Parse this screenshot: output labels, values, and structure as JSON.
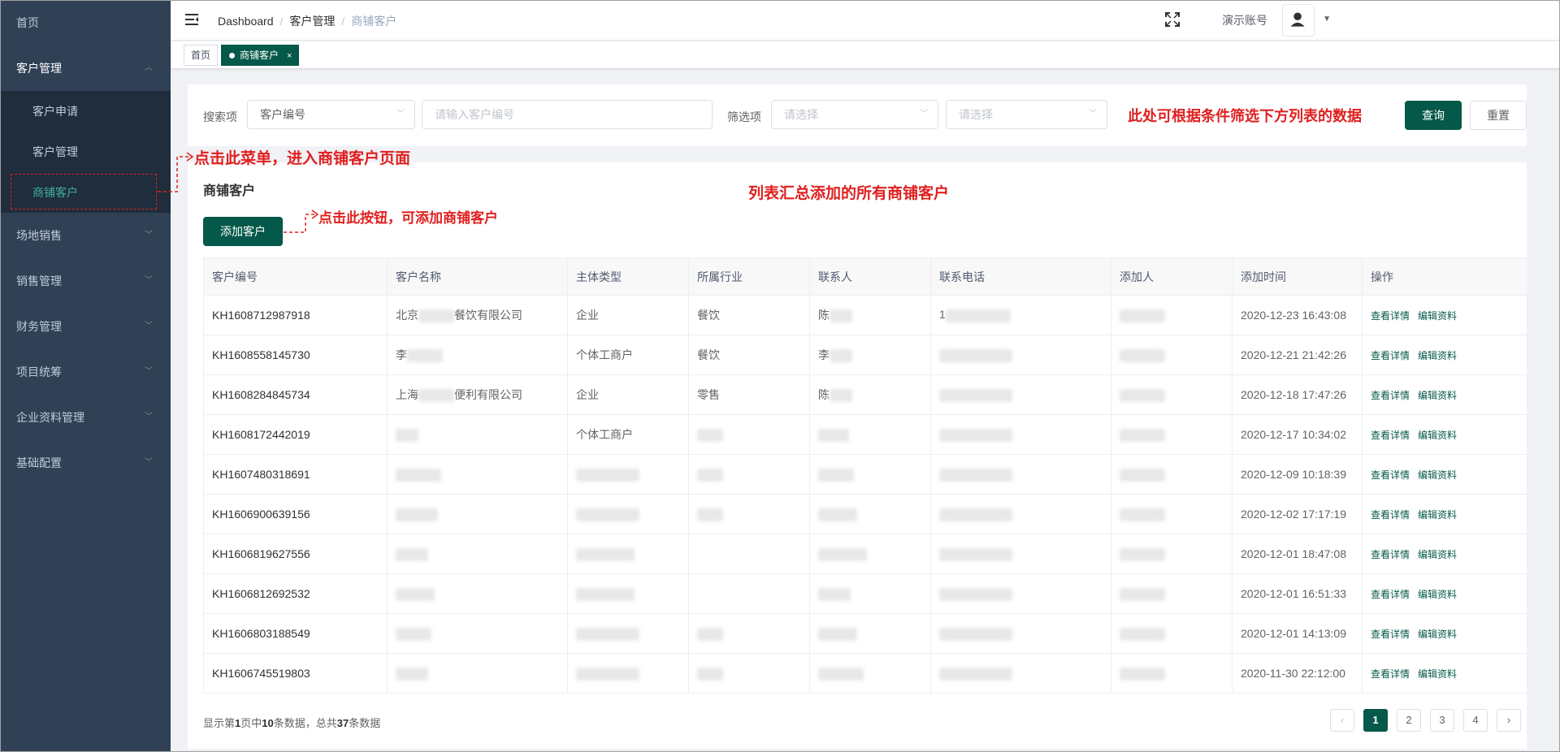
{
  "sidebar": {
    "items": [
      {
        "label": "首页"
      },
      {
        "label": "客户管理",
        "expanded": true,
        "children": [
          {
            "label": "客户申请"
          },
          {
            "label": "客户管理"
          },
          {
            "label": "商铺客户",
            "active": true
          }
        ]
      },
      {
        "label": "场地销售"
      },
      {
        "label": "销售管理"
      },
      {
        "label": "财务管理"
      },
      {
        "label": "项目统筹"
      },
      {
        "label": "企业资料管理"
      },
      {
        "label": "基础配置"
      }
    ]
  },
  "header": {
    "breadcrumb": [
      "Dashboard",
      "客户管理",
      "商铺客户"
    ],
    "account_name": "演示账号"
  },
  "tags": [
    {
      "label": "首页"
    },
    {
      "label": "商铺客户",
      "close": "×"
    }
  ],
  "search": {
    "search_label": "搜索项",
    "search_field": "客户编号",
    "search_input_placeholder": "请输入客户编号",
    "filter_label": "筛选项",
    "filter1_placeholder": "请选择",
    "filter2_placeholder": "请选择",
    "query_button": "查询",
    "reset_button": "重置"
  },
  "panel": {
    "title": "商铺客户",
    "add_button": "添加客户"
  },
  "table": {
    "columns": [
      "客户编号",
      "客户名称",
      "主体类型",
      "所属行业",
      "联系人",
      "联系电话",
      "添加人",
      "添加时间",
      "操作"
    ],
    "rows": [
      {
        "code": "KH1608712987918",
        "name_pre": "北京",
        "name_post": "餐饮有限公司",
        "type": "企业",
        "industry": "餐饮",
        "contact": "陈",
        "phone": "1",
        "time": "2020-12-23 16:43:08"
      },
      {
        "code": "KH1608558145730",
        "name_pre": "李",
        "name_post": "",
        "type": "个体工商户",
        "industry": "餐饮",
        "contact": "李",
        "phone": "",
        "time": "2020-12-21 21:42:26"
      },
      {
        "code": "KH1608284845734",
        "name_pre": "上海",
        "name_post": "便利有限公司",
        "type": "企业",
        "industry": "零售",
        "contact": "陈",
        "phone": "",
        "time": "2020-12-18 17:47:26"
      },
      {
        "code": "KH1608172442019",
        "name_pre": "",
        "name_post": "",
        "type": "个体工商户",
        "industry": "",
        "contact": "",
        "phone": "",
        "time": "2020-12-17 10:34:02"
      },
      {
        "code": "KH1607480318691",
        "name_pre": "",
        "name_post": "",
        "type": "",
        "industry": "",
        "contact": "",
        "phone": "",
        "time": "2020-12-09 10:18:39"
      },
      {
        "code": "KH1606900639156",
        "name_pre": "",
        "name_post": "",
        "type": "",
        "industry": "",
        "contact": "",
        "phone": "",
        "time": "2020-12-02 17:17:19"
      },
      {
        "code": "KH1606819627556",
        "name_pre": "",
        "name_post": "",
        "type": "",
        "industry": "",
        "contact": "",
        "phone": "",
        "time": "2020-12-01 18:47:08"
      },
      {
        "code": "KH1606812692532",
        "name_pre": "",
        "name_post": "",
        "type": "",
        "industry": "",
        "contact": "",
        "phone": "",
        "time": "2020-12-01 16:51:33"
      },
      {
        "code": "KH1606803188549",
        "name_pre": "",
        "name_post": "",
        "type": "",
        "industry": "",
        "contact": "",
        "phone": "",
        "time": "2020-12-01 14:13:09"
      },
      {
        "code": "KH1606745519803",
        "name_pre": "",
        "name_post": "",
        "type": "",
        "industry": "",
        "contact": "",
        "phone": "",
        "time": "2020-11-30 22:12:00"
      }
    ],
    "op_view": "查看详情",
    "op_edit": "编辑资料"
  },
  "footer": {
    "text_prefix": "显示第",
    "current_page": "1",
    "text_mid": "页中",
    "page_size": "10",
    "text_mid2": "条数据，总共",
    "total": "37",
    "text_suffix": "条数据"
  },
  "pagination": {
    "prev": "‹",
    "pages": [
      "1",
      "2",
      "3",
      "4"
    ],
    "next": "›"
  },
  "annotations": {
    "menu_note": "点击此菜单，进入商铺客户页面",
    "button_note": "点击此按钮，可添加商铺客户",
    "filter_note": "此处可根据条件筛选下方列表的数据",
    "list_note": "列表汇总添加的所有商铺客户"
  },
  "colors": {
    "primary": "#05594a",
    "sidebar_bg": "#304156",
    "sidebar_active_text": "#3fb0a0",
    "annotation_red": "#e02020"
  }
}
